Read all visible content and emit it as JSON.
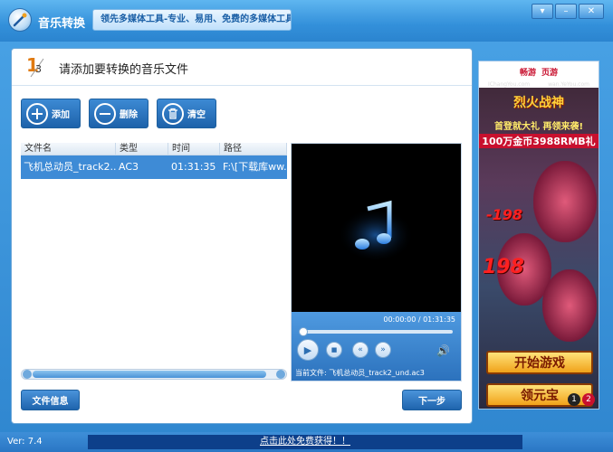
{
  "app": {
    "title": "音乐转换",
    "slogan": "领先多媒体工具-专业、易用、免费的多媒体工具"
  },
  "window": {
    "min_label": "▾",
    "restore_label": "–",
    "close_label": "✕"
  },
  "step": {
    "current": "1",
    "total": "3",
    "title": "请添加要转换的音乐文件"
  },
  "toolbar": {
    "add_label": "添加",
    "delete_label": "删除",
    "clear_label": "清空"
  },
  "file_list": {
    "columns": [
      "文件名",
      "类型",
      "时间",
      "路径"
    ],
    "rows": [
      {
        "name": "飞机总动员_track2...",
        "type": "AC3",
        "time": "01:31:35",
        "path": "F:\\[下载库ww..."
      }
    ]
  },
  "player": {
    "time": "00:00:00 / 01:31:35",
    "progress": 0,
    "current_file_label": "当前文件: 飞机总动员_track2_und.ac3",
    "play_icon": "▶",
    "stop_icon": "■",
    "prev_icon": "«",
    "next_icon": "»",
    "volume_icon": "🔊"
  },
  "footer": {
    "file_info_label": "文件信息",
    "next_label": "下一步"
  },
  "ad": {
    "brand1": "畅游",
    "brand2": "页游",
    "sub1": "IChangYou.com",
    "sub2": "wan.YeYou.com",
    "title": "烈火战神",
    "line1": "首登就大礼 再领来袭!",
    "line2": "100万金币3988RMB礼",
    "dmg1": "-198",
    "dmg2": "198",
    "start_btn": "开始游戏",
    "gift_btn": "领元宝",
    "page1": "1",
    "page2": "2"
  },
  "status": {
    "version": "Ver: 7.4",
    "promo": "点击此处免费获得！！"
  },
  "colors": {
    "accent": "#2f86cf",
    "selection": "#3e8bd6",
    "ad_red": "#c8102e"
  }
}
